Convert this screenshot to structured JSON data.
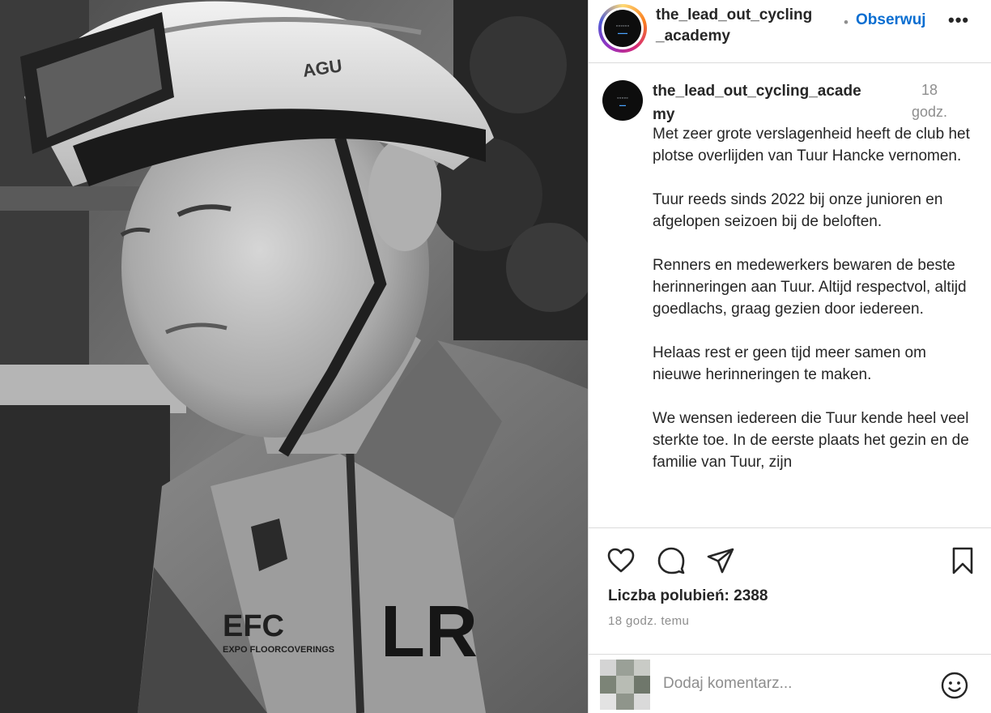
{
  "post": {
    "photo_alt": "Black-and-white portrait of a young cyclist wearing a helmet and team jersey",
    "helmet_brand": "AGU",
    "jersey_brand": "EFC",
    "jersey_sub": "EXPO FLOORCOVERINGS",
    "jersey_logo": "LR"
  },
  "header": {
    "username_line1": "the_lead_out_cycling",
    "username_line2": "_academy",
    "separator": "•",
    "follow_label": "Obserwuj",
    "more_label": "•••"
  },
  "caption": {
    "username_line1": "the_lead_out_cycling_acade",
    "username_line2": "my",
    "time_line1": "18",
    "time_line2": "godz.",
    "paragraphs": [
      "Met zeer grote verslagenheid heeft de club het plotse overlijden van Tuur Hancke vernomen.",
      "Tuur reeds sinds 2022 bij onze junioren en afgelopen seizoen bij de beloften.",
      "Renners en medewerkers bewaren de beste herinneringen aan Tuur. Altijd respectvol, altijd goedlachs, graag gezien door iedereen.",
      "Helaas rest er geen tijd meer samen om nieuwe herinneringen te maken.",
      "We wensen iedereen die Tuur kende heel veel sterkte toe. In de eerste plaats het gezin en de familie van Tuur, zijn"
    ]
  },
  "actions": {
    "icons": [
      "heart-icon",
      "comment-icon",
      "share-icon",
      "bookmark-icon"
    ],
    "likes_text": "Liczba polubień: 2388",
    "time_ago": "18 godz. temu"
  },
  "comment": {
    "placeholder": "Dodaj komentarz...",
    "emoji_icon": "smiley-icon"
  },
  "colors": {
    "follow": "#0a6ed1",
    "muted": "#8e8e8e",
    "text": "#262626",
    "border": "#dbdbdb"
  }
}
